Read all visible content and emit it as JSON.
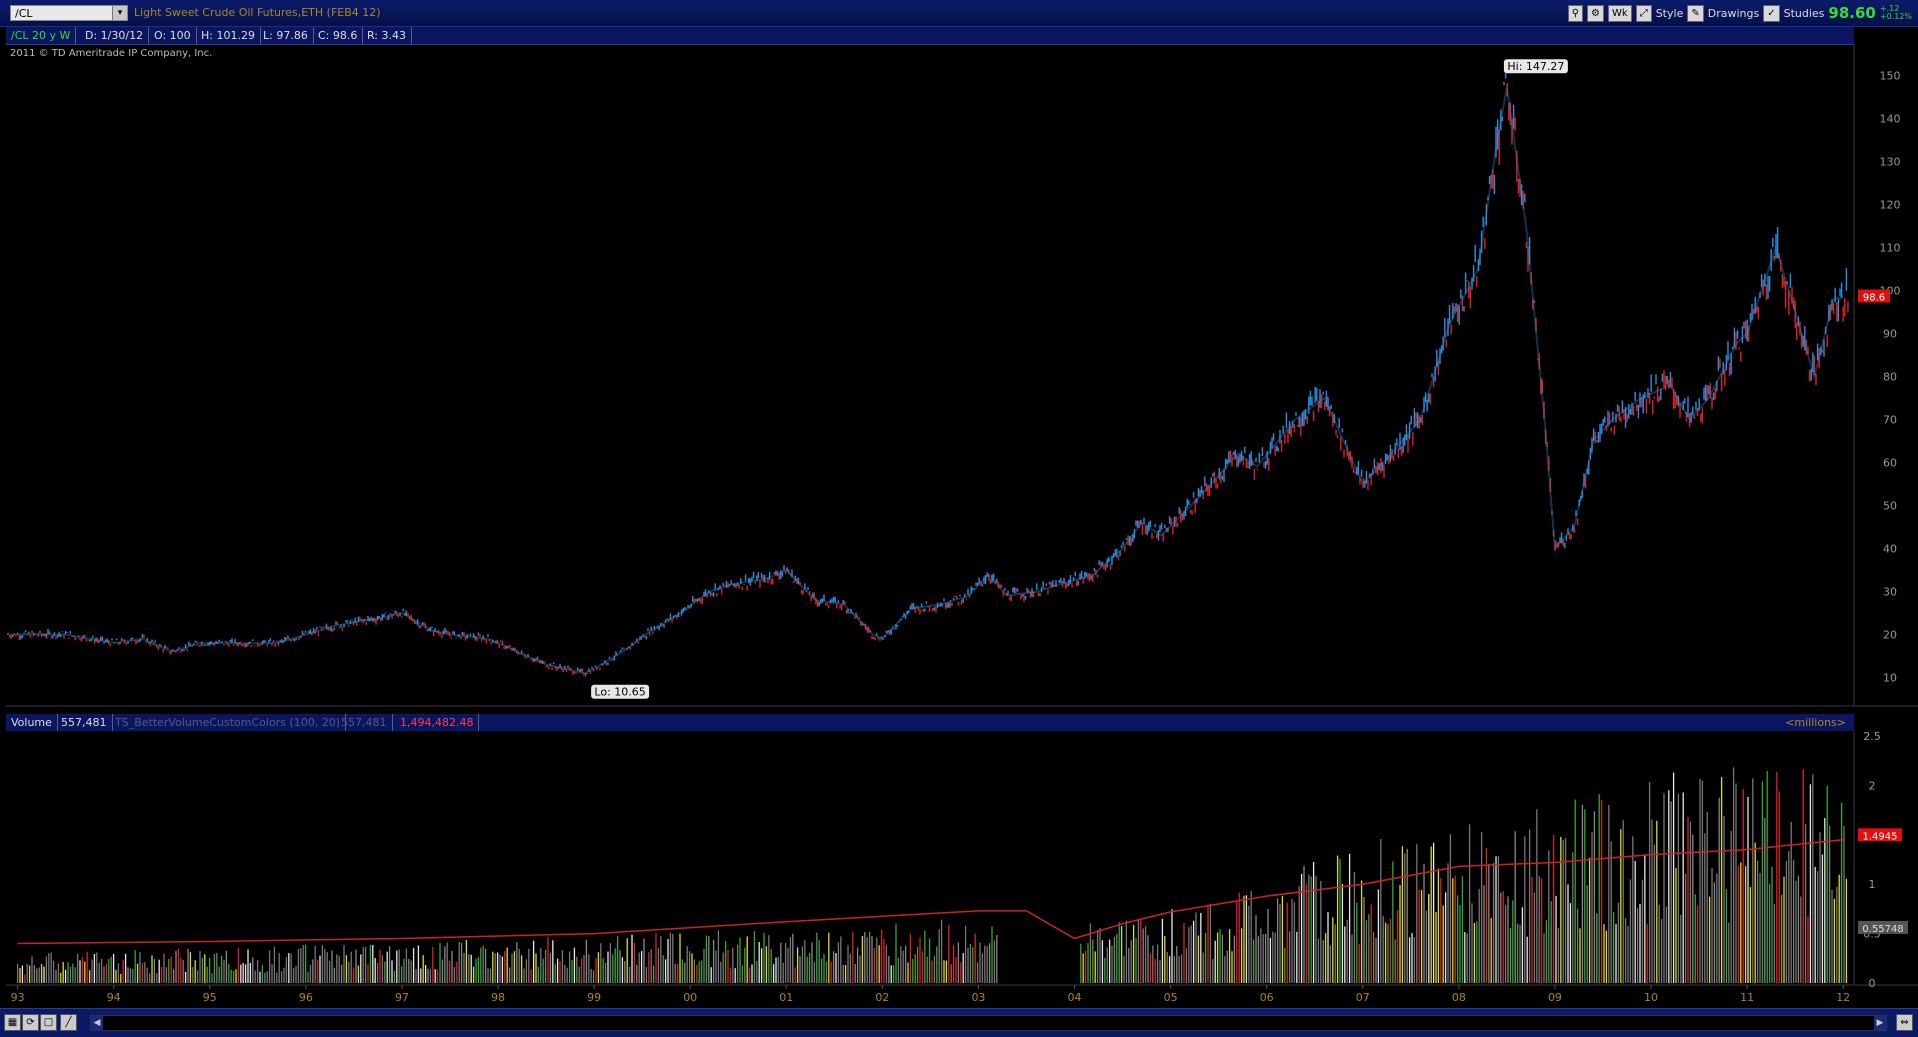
{
  "header": {
    "symbol": "/CL",
    "description": "Light Sweet Crude Oil Futures,ETH (FEB4 12)",
    "buttons": {
      "timeframe": "Wk",
      "style": "Style",
      "drawings": "Drawings",
      "studies": "Studies"
    },
    "last_price": "98.60",
    "change": "+.12",
    "change_pct": "+0.12%"
  },
  "info": {
    "aggregation": "/CL 20 y W",
    "date": "D: 1/30/12",
    "open": "O: 100",
    "high": "H: 101.29",
    "low": "L: 97.86",
    "close": "C: 98.6",
    "range": "R: 3.43",
    "copyright": "2011 © TD Ameritrade IP Company, Inc."
  },
  "volume_info": {
    "label": "Volume",
    "value": "557,481",
    "study": "TS_BetterVolumeCustomColors (100, 20)",
    "study_value": "557,481",
    "avg_value": "1,494,482.48",
    "units": "<millions>"
  },
  "colors": {
    "up": "#2a8fe0",
    "down": "#e02020",
    "background": "#000000",
    "panel": "#0a1660"
  },
  "chart_data": [
    {
      "type": "line",
      "title": "Light Sweet Crude Oil Futures,ETH (FEB4 12)",
      "x_ticks": [
        "93",
        "94",
        "95",
        "96",
        "97",
        "98",
        "99",
        "00",
        "01",
        "02",
        "03",
        "04",
        "05",
        "06",
        "07",
        "08",
        "09",
        "10",
        "11",
        "12"
      ],
      "ylim": [
        5,
        155
      ],
      "y_ticks": [
        10,
        20,
        30,
        40,
        50,
        60,
        70,
        80,
        90,
        100,
        110,
        120,
        130,
        140,
        150
      ],
      "series": [
        {
          "x": [
            1993.0,
            1993.5,
            1994.0,
            1994.3,
            1994.6,
            1994.9,
            1995.3,
            1995.7,
            1996.0,
            1996.3,
            1996.8,
            1997.0,
            1997.3,
            1997.5,
            1997.9,
            1998.2,
            1998.5,
            1998.9,
            1999.0,
            1999.3,
            1999.6,
            1999.9,
            2000.2,
            2000.5,
            2000.8,
            2001.0,
            2001.3,
            2001.6,
            2001.9,
            2002.0,
            2002.3,
            2002.6,
            2002.9,
            2003.1,
            2003.3,
            2003.6,
            2003.9,
            2004.2,
            2004.5,
            2004.7,
            2004.9,
            2005.3,
            2005.7,
            2005.9,
            2006.3,
            2006.6,
            2006.9,
            2007.0,
            2007.3,
            2007.6,
            2007.9,
            2008.2,
            2008.4,
            2008.5,
            2008.7,
            2008.9,
            2009.0,
            2009.2,
            2009.4,
            2009.6,
            2009.9,
            2010.2,
            2010.4,
            2010.6,
            2010.9,
            2011.0,
            2011.3,
            2011.5,
            2011.7,
            2011.9,
            2012.0
          ],
          "values": [
            20,
            20,
            18,
            19,
            16,
            18,
            18,
            18,
            20,
            22,
            24,
            25,
            21,
            20,
            19,
            16,
            13,
            11,
            12,
            16,
            21,
            25,
            30,
            32,
            33,
            35,
            28,
            27,
            20,
            19,
            26,
            27,
            29,
            34,
            29,
            30,
            32,
            34,
            40,
            46,
            43,
            52,
            62,
            59,
            70,
            75,
            60,
            55,
            62,
            70,
            92,
            105,
            135,
            147.27,
            115,
            68,
            40,
            45,
            65,
            70,
            75,
            78,
            70,
            75,
            88,
            90,
            110,
            95,
            80,
            98,
            98.6
          ],
          "hi": 147.27,
          "lo": 10.65
        }
      ],
      "last_value": "98.6",
      "annotations": [
        "Hi: 147.27",
        "Lo: 10.65"
      ]
    },
    {
      "type": "bar",
      "title": "Volume",
      "ylim": [
        0,
        2.5
      ],
      "y_ticks": [
        0,
        0.5,
        1,
        1.5,
        2,
        2.5
      ],
      "ylabel": "<millions>",
      "series": [
        {
          "x": [
            1993.0,
            1994.0,
            1995.0,
            1996.0,
            1997.0,
            1998.0,
            1999.0,
            2000.0,
            2001.0,
            2002.0,
            2003.0,
            2004.0,
            2004.1,
            2005.0,
            2006.0,
            2007.0,
            2008.0,
            2009.0,
            2010.0,
            2011.0,
            2012.0
          ],
          "values": [
            0.2,
            0.22,
            0.24,
            0.26,
            0.28,
            0.3,
            0.32,
            0.35,
            0.37,
            0.4,
            0.45,
            0.1,
            0.4,
            0.5,
            0.7,
            0.95,
            1.1,
            1.2,
            1.4,
            1.5,
            1.45
          ]
        },
        {
          "x": [
            1993.0,
            1995.0,
            1997.0,
            1999.0,
            2001.0,
            2003.0,
            2003.5,
            2004.0,
            2004.5,
            2005.0,
            2006.0,
            2007.0,
            2008.0,
            2008.5,
            2009.0,
            2010.0,
            2011.0,
            2012.0
          ],
          "values": [
            0.4,
            0.42,
            0.45,
            0.5,
            0.62,
            0.73,
            0.73,
            0.45,
            0.6,
            0.72,
            0.88,
            1.0,
            1.18,
            1.2,
            1.22,
            1.3,
            1.35,
            1.45
          ]
        }
      ],
      "last_value": "1.4945",
      "second_value": "0.55748"
    }
  ]
}
